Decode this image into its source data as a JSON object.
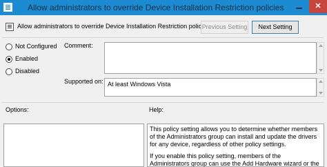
{
  "window": {
    "title": "Allow administrators to override Device Installation Restriction policies",
    "close_glyph": "✕"
  },
  "header": {
    "title": "Allow administrators to override Device Installation Restriction policies",
    "previous_label": "Previous Setting",
    "next_label": "Next Setting"
  },
  "state": {
    "options": [
      {
        "label": "Not Configured",
        "checked": false
      },
      {
        "label": "Enabled",
        "checked": true
      },
      {
        "label": "Disabled",
        "checked": false
      }
    ]
  },
  "comment": {
    "label": "Comment:",
    "value": ""
  },
  "supported": {
    "label": "Supported on:",
    "value": "At least Windows Vista"
  },
  "options_pane": {
    "label": "Options:"
  },
  "help_pane": {
    "label": "Help:",
    "paragraphs": [
      "This policy setting allows you to determine whether members of the Administrators group can install and update the drivers for any device, regardless of other policy settings.",
      "If you enable this policy setting, members of the Administrators group can use the Add Hardware wizard or the Update Driver"
    ]
  }
}
